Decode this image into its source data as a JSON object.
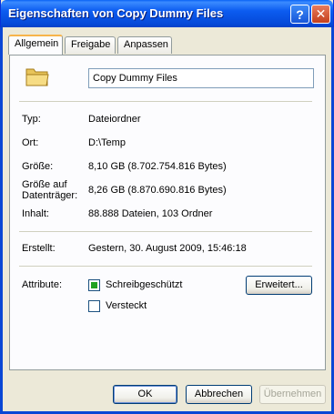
{
  "window": {
    "title": "Eigenschaften von Copy Dummy Files",
    "help_label": "?",
    "close_label": "✕"
  },
  "tabs": [
    {
      "label": "Allgemein",
      "active": true
    },
    {
      "label": "Freigabe",
      "active": false
    },
    {
      "label": "Anpassen",
      "active": false
    }
  ],
  "general": {
    "folder_icon": "folder-icon",
    "name": "Copy Dummy Files",
    "type_label": "Typ:",
    "type_value": "Dateiordner",
    "location_label": "Ort:",
    "location_value": "D:\\Temp",
    "size_label": "Größe:",
    "size_value": "8,10 GB (8.702.754.816 Bytes)",
    "disk_size_label_1": "Größe auf",
    "disk_size_label_2": "Datenträger:",
    "disk_size_value": "8,26 GB (8.870.690.816 Bytes)",
    "contents_label": "Inhalt:",
    "contents_value": "88.888 Dateien, 103 Ordner",
    "created_label": "Erstellt:",
    "created_value": "Gestern, 30. August 2009, 15:46:18",
    "attributes_label": "Attribute:",
    "readonly_label": "Schreibgeschützt",
    "readonly_checked": true,
    "hidden_label": "Versteckt",
    "hidden_checked": false,
    "advanced_button": "Erweitert..."
  },
  "buttons": {
    "ok": "OK",
    "cancel": "Abbrechen",
    "apply": "Übernehmen"
  },
  "colors": {
    "titlebar": "#0a52e0",
    "face": "#ece9d8",
    "tab_highlight": "#f7b44b",
    "check_fill": "#21a121"
  }
}
